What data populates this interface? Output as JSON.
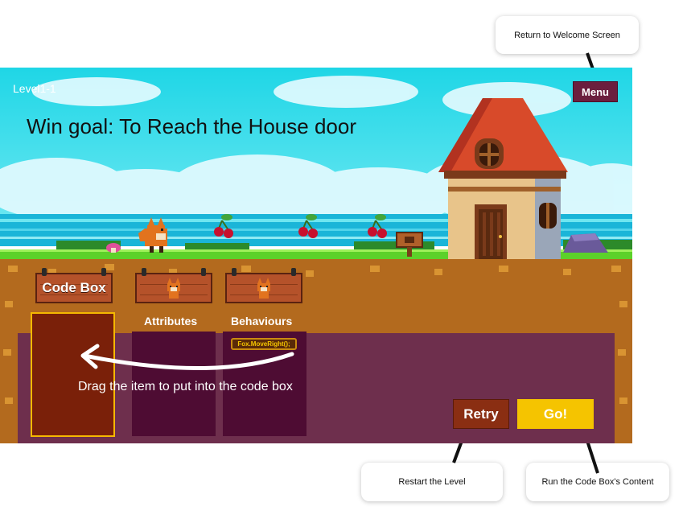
{
  "callouts": {
    "menu": "Return to Welcome Screen",
    "retry": "Restart the Level",
    "go": "Run the Code Box's Content"
  },
  "hud": {
    "level": "Level1-1",
    "goal": "Win goal: To Reach the House door",
    "menu_label": "Menu"
  },
  "panel": {
    "code_box_title": "Code Box",
    "attributes_label": "Attributes",
    "behaviours_label": "Behaviours",
    "behaviour_items": [
      "Fox.MoveRight();"
    ],
    "drag_hint": "Drag the item to put into the code box",
    "retry_label": "Retry",
    "go_label": "Go!"
  },
  "colors": {
    "sky": "#2fd9e8",
    "panel": "#6e2f4d",
    "slot": "#4e0c33",
    "code_box": "#7a2009",
    "code_box_border": "#f5b800",
    "go": "#f5c400",
    "retry": "#8a2e12",
    "menu": "#6b1f3e"
  },
  "icons": [
    "fox-character-icon",
    "cherry-icon",
    "house-icon",
    "signpost-icon",
    "mushroom-icon",
    "rock-icon"
  ]
}
